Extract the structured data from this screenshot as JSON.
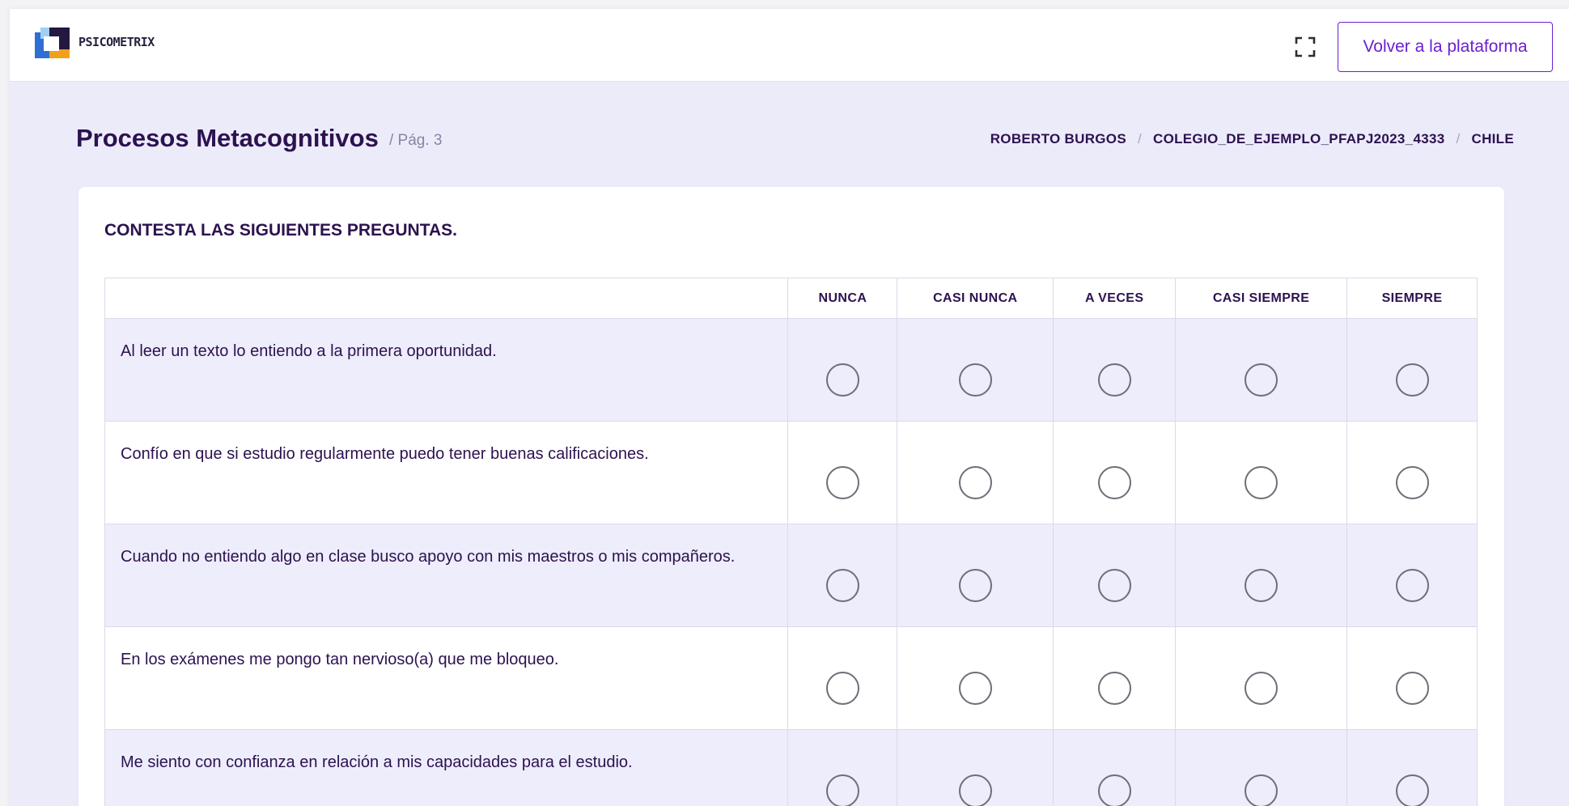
{
  "app": {
    "logo_text": "PSICOMETRIX",
    "back_button": "Volver a la plataforma"
  },
  "header": {
    "title": "Procesos Metacognitivos",
    "page_label": "/ Pág. 3",
    "breadcrumb": [
      "ROBERTO BURGOS",
      "COLEGIO_DE_EJEMPLO_PFAPJ2023_4333",
      "CHILE"
    ],
    "breadcrumb_separator": "/"
  },
  "card": {
    "instruction": "CONTESTA LAS SIGUIENTES PREGUNTAS."
  },
  "table": {
    "columns": [
      "NUNCA",
      "CASI NUNCA",
      "A VECES",
      "CASI SIEMPRE",
      "SIEMPRE"
    ],
    "rows": [
      {
        "question": "Al leer un texto lo entiendo a la primera oportunidad.",
        "selected": null
      },
      {
        "question": "Confío en que si estudio regularmente puedo tener buenas calificaciones.",
        "selected": null
      },
      {
        "question": "Cuando no entiendo algo en clase busco apoyo con mis maestros o mis compañeros.",
        "selected": null
      },
      {
        "question": "En los exámenes me pongo tan nervioso(a) que me bloqueo.",
        "selected": null
      },
      {
        "question": "Me siento con confianza en relación a mis capacidades para el estudio.",
        "selected": null
      }
    ]
  },
  "colors": {
    "accent": "#6a1fd0",
    "text_dark": "#2c1250",
    "page_bg": "#ecebfa",
    "row_shade": "#eeedfb"
  },
  "icons": {
    "logo": "psicometrix-logo",
    "fullscreen": "expand-icon",
    "radio": "radio-empty"
  }
}
